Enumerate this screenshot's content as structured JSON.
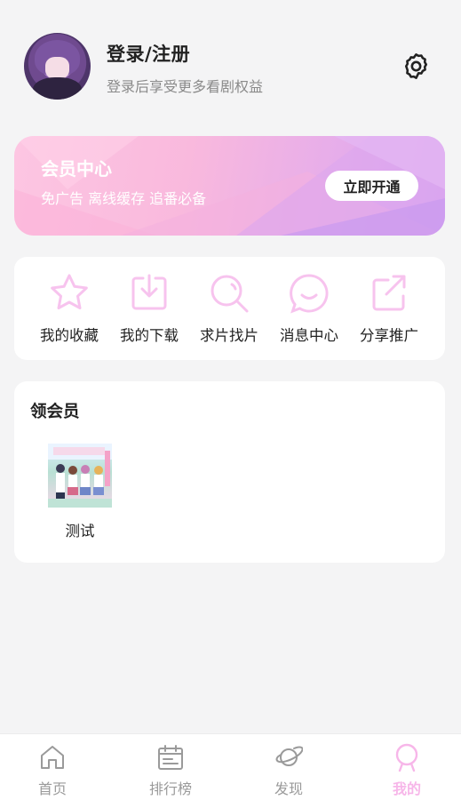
{
  "profile": {
    "title": "登录/注册",
    "subtitle": "登录后享受更多看剧权益",
    "avatar_icon": "avatar",
    "settings_icon": "gear-icon"
  },
  "vip_banner": {
    "title": "会员中心",
    "subtitle": "免广告 离线缓存 追番必备",
    "button_label": "立即开通",
    "colors": {
      "from": "#fdc6e2",
      "to": "#d5a3f2"
    }
  },
  "menu": {
    "icon_color": "#f7c3ee",
    "items": [
      {
        "label": "我的收藏",
        "icon": "star-icon"
      },
      {
        "label": "我的下载",
        "icon": "download-icon"
      },
      {
        "label": "求片找片",
        "icon": "search-icon"
      },
      {
        "label": "消息中心",
        "icon": "message-icon"
      },
      {
        "label": "分享推广",
        "icon": "share-icon"
      }
    ]
  },
  "claim": {
    "title": "领会员",
    "items": [
      {
        "name": "测试"
      }
    ]
  },
  "bottom_nav": {
    "active_color": "#f7b6e9",
    "items": [
      {
        "label": "首页",
        "icon": "home-icon",
        "active": false
      },
      {
        "label": "排行榜",
        "icon": "calendar-icon",
        "active": false
      },
      {
        "label": "发现",
        "icon": "planet-icon",
        "active": false
      },
      {
        "label": "我的",
        "icon": "profile-icon",
        "active": true
      }
    ]
  }
}
